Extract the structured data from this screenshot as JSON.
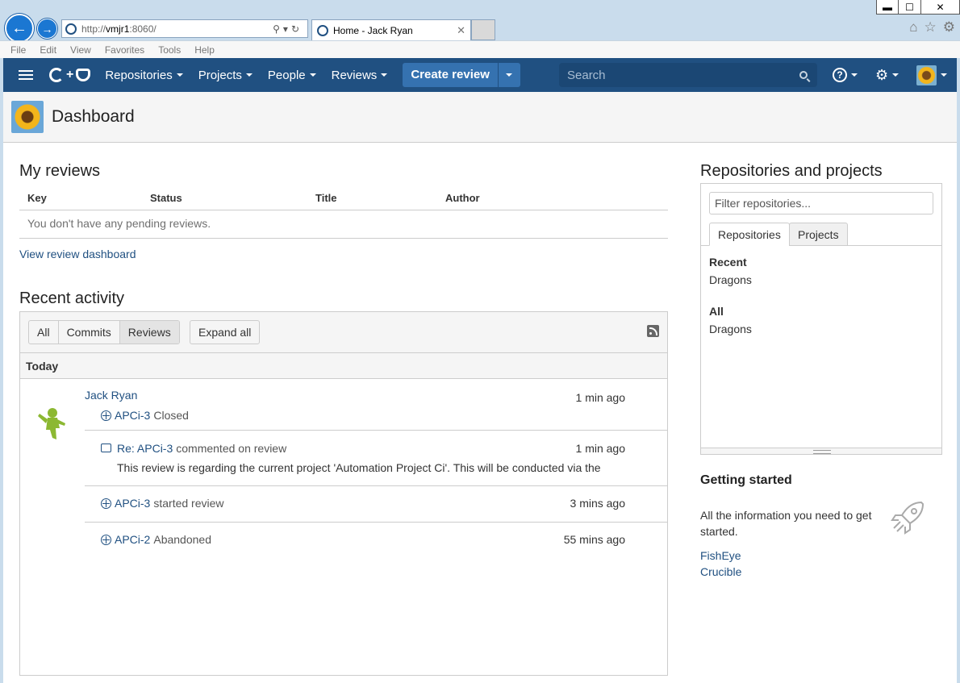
{
  "browser": {
    "url_prefix": "http://",
    "url_host": "vmjr1",
    "url_rest": ":8060/",
    "tab_title": "Home - Jack Ryan",
    "window_controls": {
      "minimize": "▬",
      "maximize": "☐",
      "close": "✕"
    },
    "menu": [
      "File",
      "Edit",
      "View",
      "Favorites",
      "Tools",
      "Help"
    ]
  },
  "header": {
    "logo_plus": "+",
    "nav": [
      "Repositories",
      "Projects",
      "People",
      "Reviews"
    ],
    "create_review": "Create review",
    "search_placeholder": "Search",
    "help_glyph": "?",
    "settings_glyph": "⚙"
  },
  "page": {
    "title": "Dashboard"
  },
  "my_reviews": {
    "heading": "My reviews",
    "columns": [
      "Key",
      "Status",
      "Title",
      "Author"
    ],
    "empty_text": "You don't have any pending reviews.",
    "dashboard_link": "View review dashboard"
  },
  "recent_activity": {
    "heading": "Recent activity",
    "filters": [
      "All",
      "Commits",
      "Reviews"
    ],
    "active_filter": "Reviews",
    "expand_all": "Expand all",
    "group_label": "Today",
    "user": "Jack Ryan",
    "items": [
      {
        "link": "APCi-3",
        "text": "Closed",
        "time": "1 min ago"
      },
      {
        "link": "Re: APCi-3",
        "text": "commented on review",
        "time": "1 min ago",
        "snippet": "This review is regarding the current project 'Automation Project Ci'. This will be conducted via the"
      },
      {
        "link": "APCi-3",
        "text": "started review",
        "time": "3 mins ago"
      },
      {
        "link": "APCi-2",
        "text": "Abandoned",
        "time": "55 mins ago"
      }
    ]
  },
  "repos": {
    "heading": "Repositories and projects",
    "filter_placeholder": "Filter repositories...",
    "tabs": [
      "Repositories",
      "Projects"
    ],
    "recent_label": "Recent",
    "recent_items": [
      "Dragons"
    ],
    "all_label": "All",
    "all_items": [
      "Dragons"
    ]
  },
  "getting_started": {
    "heading": "Getting started",
    "text": "All the information you need to get started.",
    "links": [
      "FishEye",
      "Crucible"
    ]
  },
  "colors": {
    "header_bg": "#205081",
    "link": "#205081",
    "create_btn": "#3572b0"
  }
}
